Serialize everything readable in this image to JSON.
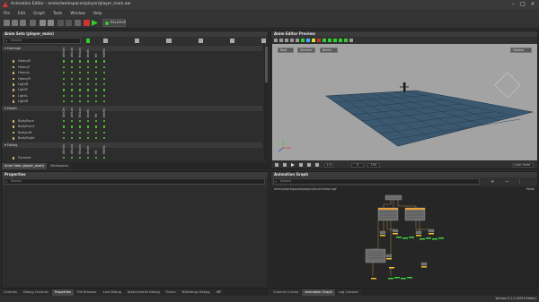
{
  "window": {
    "title": "Animation Editor - anims/workspaces/player/player_main.aw"
  },
  "menu": [
    "File",
    "Edit",
    "Graph",
    "Tools",
    "Window",
    "Help"
  ],
  "toolbar": {
    "active_button_label": "RELATIVE"
  },
  "anim_sets": {
    "title": "Anim Sets (player_main)",
    "search_placeholder": "Search",
    "columns": [
      "AtkGen",
      "AtkLow",
      "BlkLow",
      "Death",
      "Hit",
      "HitMid"
    ],
    "groups": [
      {
        "name": "Damage",
        "items": [
          "HeavyB",
          "HeavyF",
          "HeavyL",
          "HeavyR",
          "LightB",
          "LightF",
          "LightL",
          "LightR"
        ]
      },
      {
        "name": "Death",
        "items": [
          "BodyBack",
          "BodyFront",
          "BodyLeft",
          "BodyRight"
        ]
      },
      {
        "name": "Falling",
        "items": [
          "Forward",
          "ForwardLoop"
        ]
      }
    ],
    "tabs": [
      "Anim Sets (player_main)",
      "Workspace"
    ]
  },
  "preview": {
    "title": "Anim Editor Preview",
    "buttons": [
      "Root",
      "Skeleton",
      "Bones"
    ],
    "settings_label": "Options",
    "playback": {
      "speed": "1.0",
      "frame": "0",
      "length": "100",
      "mode": "Loop Mode"
    }
  },
  "properties": {
    "title": "Properties",
    "search_placeholder": "Search"
  },
  "graph": {
    "title": "Animation Graph",
    "search_placeholder": "Search",
    "path": "anims/workspaces/player/locomotion.agf",
    "mode_label": "Mode"
  },
  "bottom_tabs_left": [
    "Controls",
    "Debug Controls",
    "Properties",
    "File Browser",
    "Live Debug",
    "Attachments Debug",
    "Errors",
    "IKSettings Debug",
    "IBP"
  ],
  "bottom_tabs_left_active": "Properties",
  "bottom_tabs_right": [
    "Channel Curves",
    "Animation Graph",
    "Log Console"
  ],
  "bottom_tabs_right_active": "Animation Graph",
  "status": {
    "version": "Version 0.1.0 (2023 Editor)"
  },
  "colors": {
    "accent_green": "#52d12c",
    "viewport_bg": "#9e9e9e",
    "grid_plane": "#2f4b63",
    "node_wire": "#d8a050"
  }
}
